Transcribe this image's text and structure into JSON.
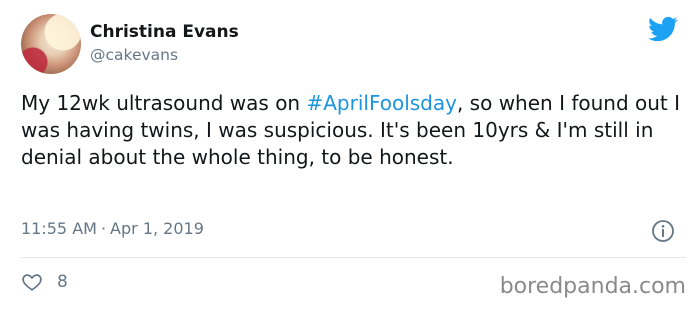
{
  "author": {
    "name": "Christina Evans",
    "handle": "@cakevans"
  },
  "tweet": {
    "text_before": "My 12wk ultrasound was on ",
    "hashtag": "#AprilFoolsday",
    "text_after": ", so when I found out I was having twins, I was suspicious. It's been 10yrs & I'm still in denial about the whole thing, to be honest.",
    "time": "11:55 AM",
    "separator": "·",
    "date": "Apr 1, 2019",
    "like_count": "8"
  },
  "icons": {
    "brand": "twitter-bird-icon",
    "info": "info-icon",
    "like": "heart-icon"
  },
  "watermark": "boredpanda.com",
  "colors": {
    "twitter_blue": "#1da1f2",
    "hashtag": "#1b95e0",
    "muted": "#657786"
  }
}
